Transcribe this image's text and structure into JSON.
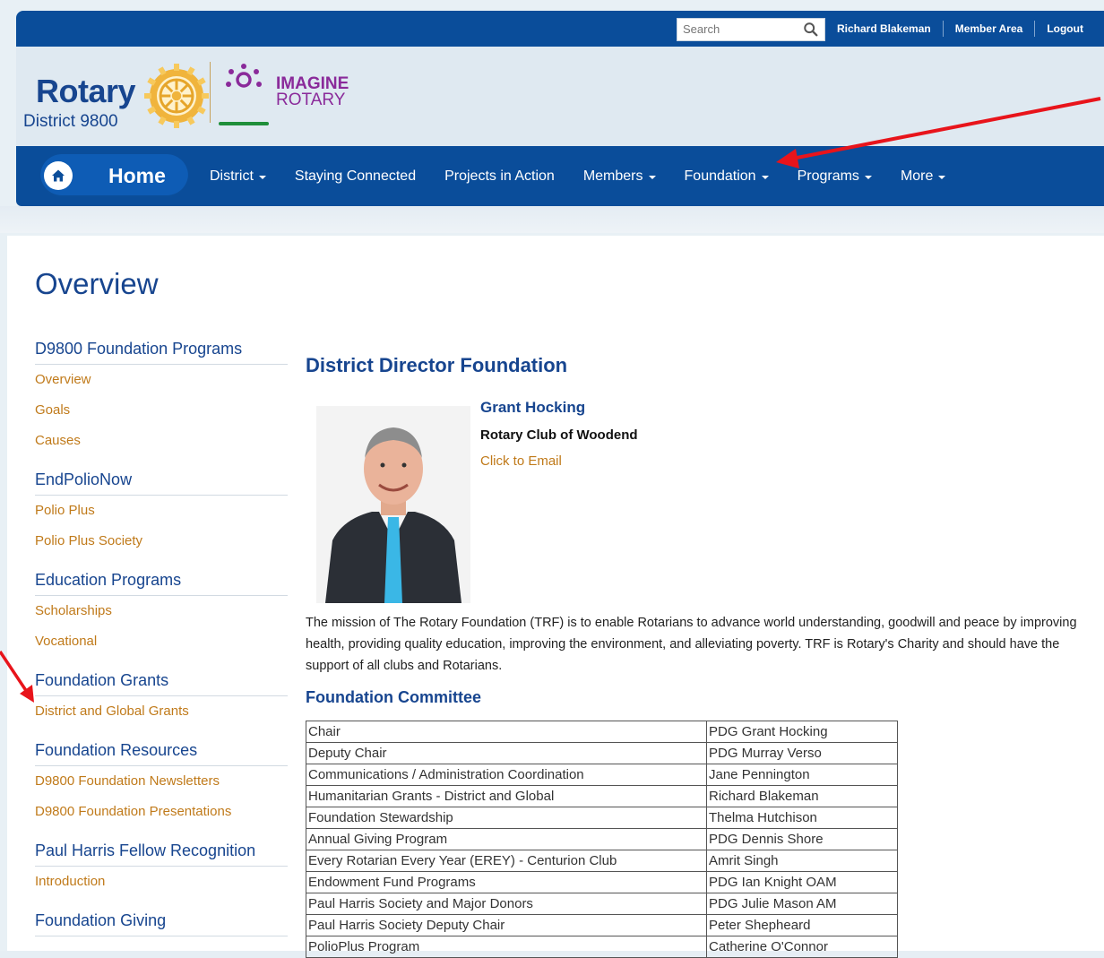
{
  "topbar": {
    "search_placeholder": "Search",
    "links": [
      "Richard Blakeman",
      "Member Area",
      "Logout"
    ]
  },
  "logo": {
    "rotary": "Rotary",
    "district": "District 9800",
    "imagine_line1": "IMAGINE",
    "imagine_line2": "ROTARY"
  },
  "nav": {
    "home": "Home",
    "items": [
      {
        "label": "District",
        "dropdown": true
      },
      {
        "label": "Staying Connected",
        "dropdown": false
      },
      {
        "label": "Projects in Action",
        "dropdown": false
      },
      {
        "label": "Members",
        "dropdown": true
      },
      {
        "label": "Foundation",
        "dropdown": true
      },
      {
        "label": "Programs",
        "dropdown": true
      },
      {
        "label": "More",
        "dropdown": true
      }
    ]
  },
  "page_title": "Overview",
  "sidebar": {
    "sections": [
      {
        "heading": "D9800 Foundation Programs",
        "links": [
          "Overview",
          "Goals",
          "Causes"
        ]
      },
      {
        "heading": "EndPolioNow",
        "links": [
          "Polio Plus",
          "Polio Plus Society"
        ]
      },
      {
        "heading": "Education Programs",
        "links": [
          "Scholarships",
          "Vocational"
        ]
      },
      {
        "heading": "Foundation Grants",
        "links": [
          "District and Global Grants"
        ]
      },
      {
        "heading": "Foundation Resources",
        "links": [
          "D9800 Foundation Newsletters",
          "D9800 Foundation Presentations"
        ]
      },
      {
        "heading": "Paul Harris Fellow Recognition",
        "links": [
          "Introduction"
        ]
      },
      {
        "heading": "Foundation Giving",
        "links": []
      }
    ]
  },
  "main": {
    "director_heading": "District Director Foundation",
    "person_name": "Grant Hocking",
    "person_club": "Rotary Club of Woodend",
    "email_link": "Click to Email",
    "mission": "The mission of The Rotary Foundation (TRF) is to enable Rotarians to advance world understanding, goodwill and peace by improving health, providing quality education, improving the environment, and alleviating poverty.  TRF is Rotary's Charity and should have the support of all clubs and Rotarians.",
    "committee_heading": "Foundation Committee",
    "committee": [
      {
        "role": "Chair",
        "name": "PDG Grant Hocking"
      },
      {
        "role": "Deputy Chair",
        "name": "PDG Murray Verso"
      },
      {
        "role": "Communications / Administration Coordination",
        "name": "Jane Pennington"
      },
      {
        "role": "Humanitarian Grants - District and Global",
        "name": "Richard Blakeman"
      },
      {
        "role": "Foundation Stewardship",
        "name": "Thelma Hutchison"
      },
      {
        "role": "Annual Giving Program",
        "name": "PDG Dennis Shore"
      },
      {
        "role": "Every Rotarian Every Year (EREY) - Centurion Club",
        "name": "Amrit Singh"
      },
      {
        "role": "Endowment Fund Programs",
        "name": "PDG Ian Knight OAM"
      },
      {
        "role": "Paul Harris Society and Major Donors",
        "name": "PDG Julie Mason AM"
      },
      {
        "role": "Paul Harris Society Deputy Chair",
        "name": "Peter Shepheard"
      },
      {
        "role": "PolioPlus Program",
        "name": "Catherine O'Connor"
      }
    ]
  },
  "colors": {
    "brand_blue": "#0a4d9a",
    "heading_blue": "#17458f",
    "link_gold": "#c07a1a",
    "annotation_arrow": "#e8141b"
  }
}
